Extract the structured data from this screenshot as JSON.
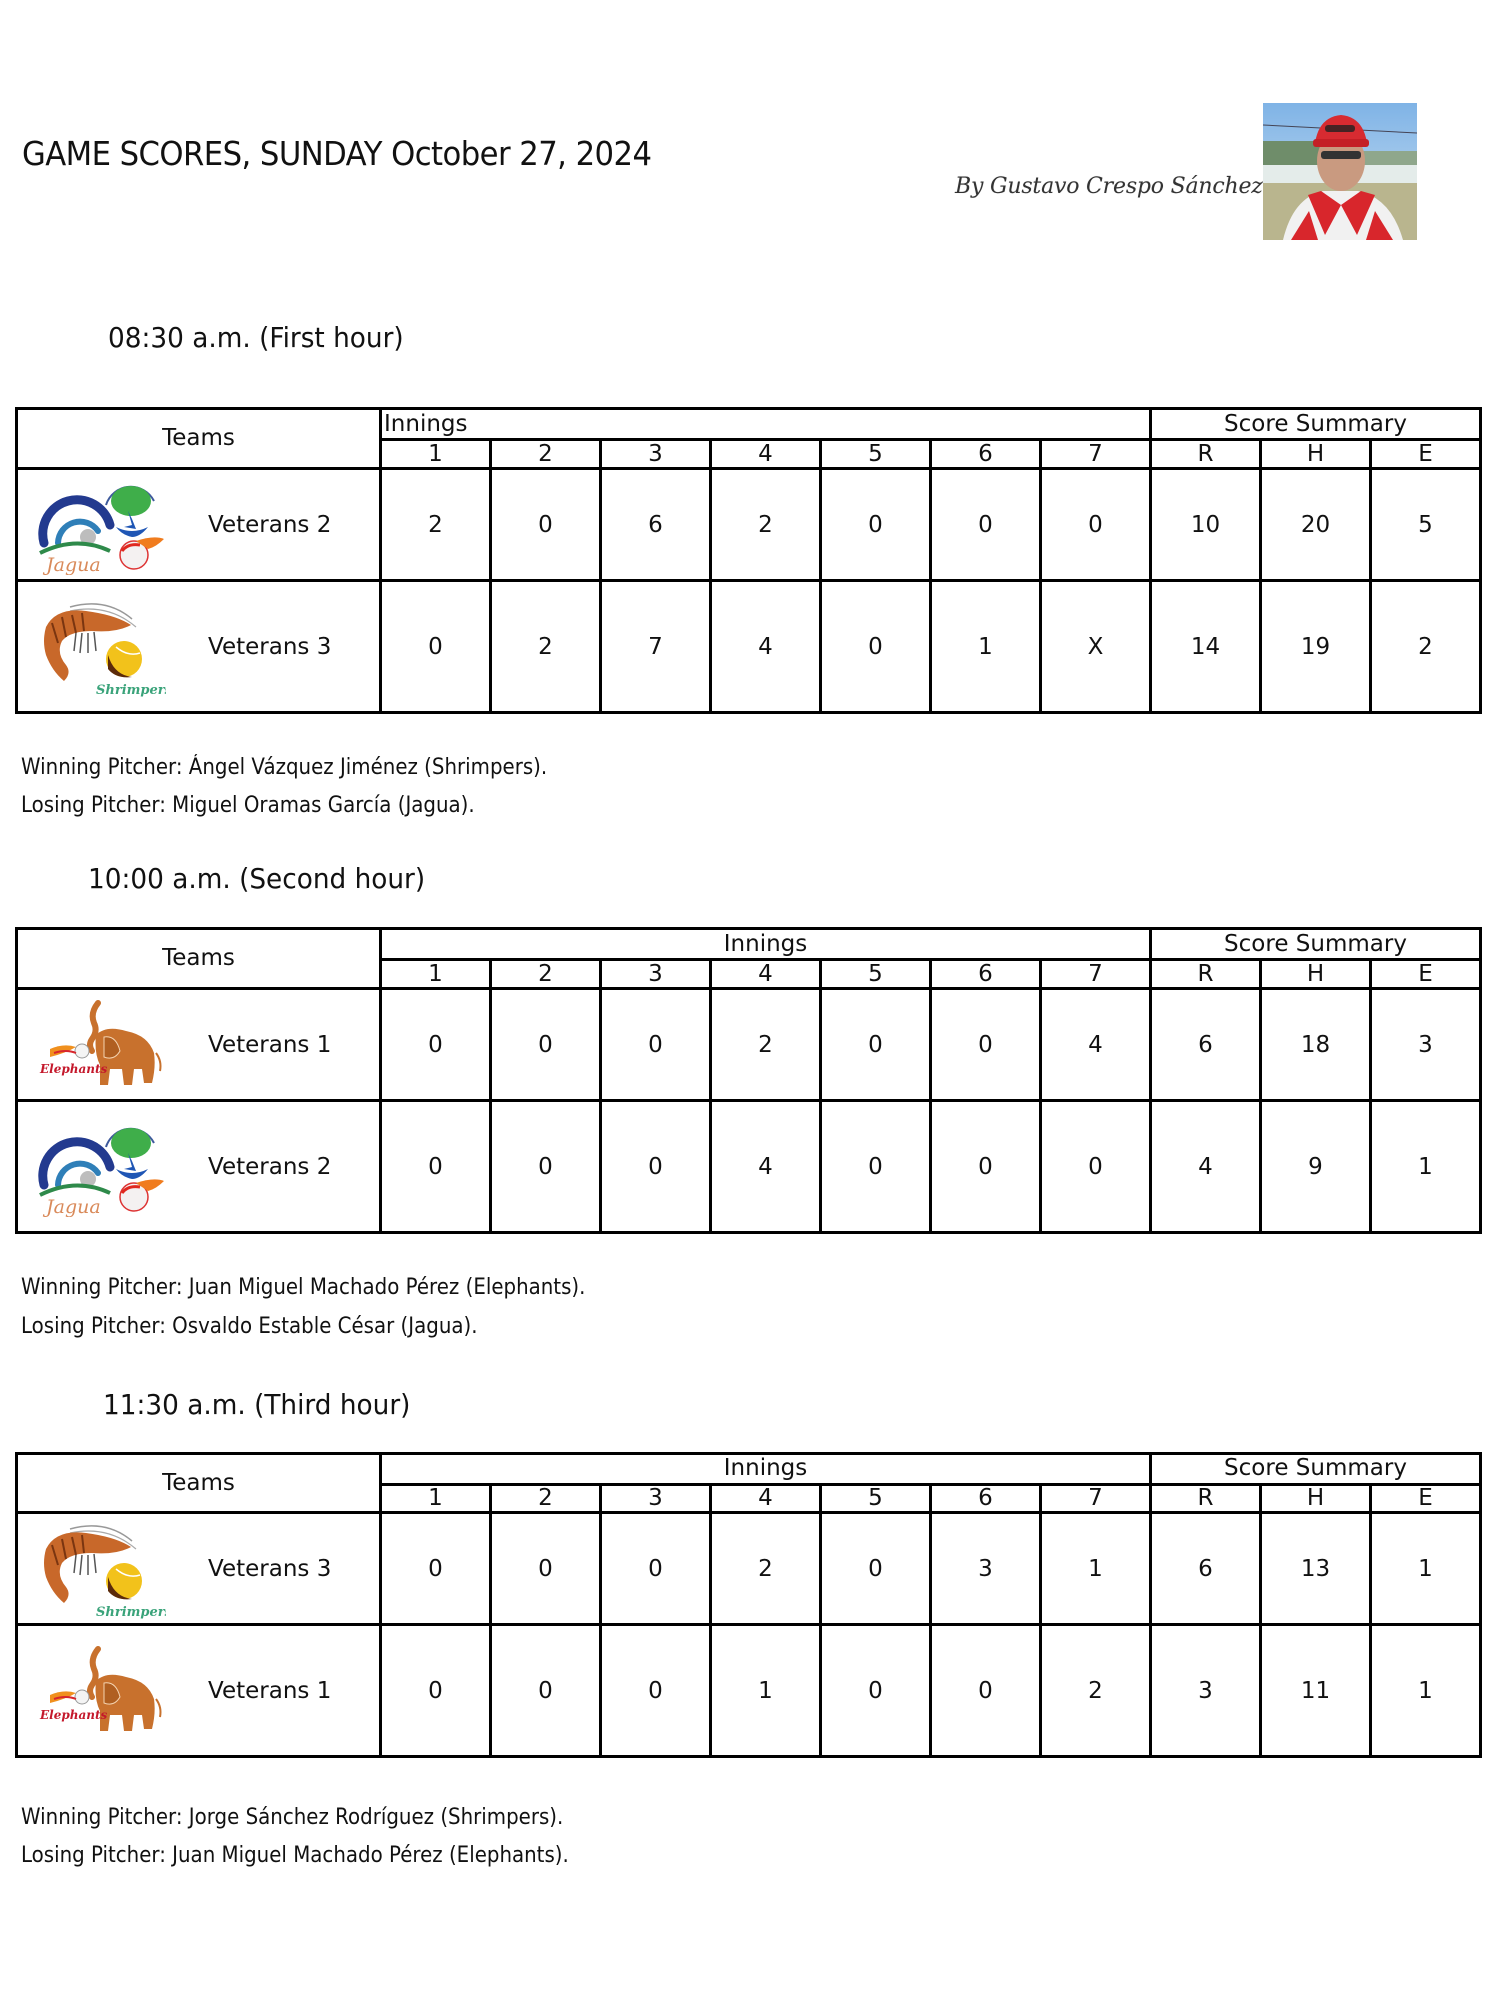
{
  "header": {
    "title": "GAME SCORES, SUNDAY October 27, 2024",
    "byline": "By Gustavo Crespo Sánchez",
    "author_photo": "author-photo"
  },
  "table_headers": {
    "teams": "Teams",
    "innings": "Innings",
    "score_summary": "Score Summary",
    "inning_numbers": [
      "1",
      "2",
      "3",
      "4",
      "5",
      "6",
      "7"
    ],
    "summary_columns": [
      "R",
      "H",
      "E"
    ]
  },
  "games": [
    {
      "time_label": "08:30 a.m. (First hour)",
      "teams": [
        {
          "name": "Veterans 2",
          "logo": "jagua-logo",
          "innings": [
            "2",
            "0",
            "6",
            "2",
            "0",
            "0",
            "0"
          ],
          "R": "10",
          "H": "20",
          "E": "5"
        },
        {
          "name": "Veterans 3",
          "logo": "shrimpers-logo",
          "innings": [
            "0",
            "2",
            "7",
            "4",
            "0",
            "1",
            "X"
          ],
          "R": "14",
          "H": "19",
          "E": "2"
        }
      ],
      "winning_pitcher": "Winning Pitcher: Ángel Vázquez Jiménez (Shrimpers).",
      "losing_pitcher": "Losing Pitcher: Miguel Oramas García (Jagua)."
    },
    {
      "time_label": "10:00 a.m. (Second hour)",
      "teams": [
        {
          "name": "Veterans 1",
          "logo": "elephants-logo",
          "innings": [
            "0",
            "0",
            "0",
            "2",
            "0",
            "0",
            "4"
          ],
          "R": "6",
          "H": "18",
          "E": "3"
        },
        {
          "name": "Veterans 2",
          "logo": "jagua-logo",
          "innings": [
            "0",
            "0",
            "0",
            "4",
            "0",
            "0",
            "0"
          ],
          "R": "4",
          "H": "9",
          "E": "1"
        }
      ],
      "winning_pitcher": "Winning Pitcher: Juan Miguel Machado Pérez (Elephants).",
      "losing_pitcher": "Losing Pitcher: Osvaldo Estable César (Jagua)."
    },
    {
      "time_label": "11:30 a.m. (Third hour)",
      "teams": [
        {
          "name": "Veterans 3",
          "logo": "shrimpers-logo",
          "innings": [
            "0",
            "0",
            "0",
            "2",
            "0",
            "3",
            "1"
          ],
          "R": "6",
          "H": "13",
          "E": "1"
        },
        {
          "name": "Veterans 1",
          "logo": "elephants-logo",
          "innings": [
            "0",
            "0",
            "0",
            "1",
            "0",
            "0",
            "2"
          ],
          "R": "3",
          "H": "11",
          "E": "1"
        }
      ],
      "winning_pitcher": "Winning Pitcher: Jorge Sánchez Rodríguez (Shrimpers).",
      "losing_pitcher": "Losing Pitcher: Juan Miguel Machado Pérez (Elephants)."
    }
  ],
  "logo_text": {
    "jagua": "Jagua",
    "shrimpers": "Shrimpers",
    "elephants": "Elephants"
  }
}
